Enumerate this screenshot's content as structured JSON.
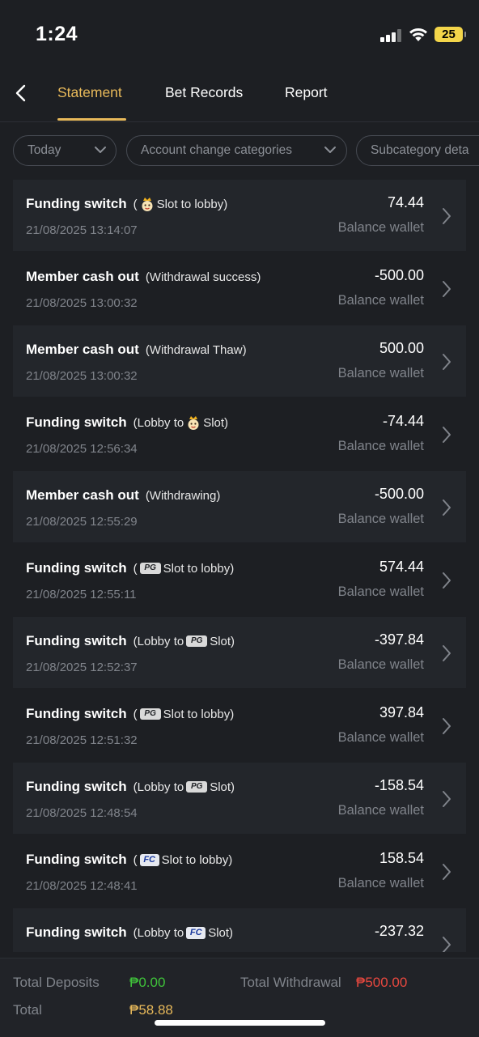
{
  "status_bar": {
    "time": "1:24",
    "battery": "25"
  },
  "nav": {
    "tabs": [
      {
        "label": "Statement",
        "active": true
      },
      {
        "label": "Bet Records",
        "active": false
      },
      {
        "label": "Report",
        "active": false
      }
    ]
  },
  "filters": [
    {
      "label": "Today"
    },
    {
      "label": "Account change categories"
    },
    {
      "label": "Subcategory deta"
    }
  ],
  "rows": [
    {
      "title": "Funding switch",
      "detail_pre": "(",
      "logo": "mascot",
      "detail_post": "Slot to lobby)",
      "date": "21/08/2025 13:14:07",
      "amount": "74.44",
      "wallet": "Balance wallet"
    },
    {
      "title": "Member cash out",
      "detail_pre": "(Withdrawal success)",
      "logo": "",
      "detail_post": "",
      "date": "21/08/2025 13:00:32",
      "amount": "-500.00",
      "wallet": "Balance wallet"
    },
    {
      "title": "Member cash out",
      "detail_pre": "(Withdrawal Thaw)",
      "logo": "",
      "detail_post": "",
      "date": "21/08/2025 13:00:32",
      "amount": "500.00",
      "wallet": "Balance wallet"
    },
    {
      "title": "Funding switch",
      "detail_pre": "(Lobby to",
      "logo": "mascot",
      "detail_post": "Slot)",
      "date": "21/08/2025 12:56:34",
      "amount": "-74.44",
      "wallet": "Balance wallet"
    },
    {
      "title": "Member cash out",
      "detail_pre": "(Withdrawing)",
      "logo": "",
      "detail_post": "",
      "date": "21/08/2025 12:55:29",
      "amount": "-500.00",
      "wallet": "Balance wallet"
    },
    {
      "title": "Funding switch",
      "detail_pre": "(",
      "logo": "pg",
      "detail_post": "Slot to lobby)",
      "date": "21/08/2025 12:55:11",
      "amount": "574.44",
      "wallet": "Balance wallet"
    },
    {
      "title": "Funding switch",
      "detail_pre": "(Lobby to",
      "logo": "pg",
      "detail_post": "Slot)",
      "date": "21/08/2025 12:52:37",
      "amount": "-397.84",
      "wallet": "Balance wallet"
    },
    {
      "title": "Funding switch",
      "detail_pre": "(",
      "logo": "pg",
      "detail_post": "Slot to lobby)",
      "date": "21/08/2025 12:51:32",
      "amount": "397.84",
      "wallet": "Balance wallet"
    },
    {
      "title": "Funding switch",
      "detail_pre": "(Lobby to",
      "logo": "pg",
      "detail_post": "Slot)",
      "date": "21/08/2025 12:48:54",
      "amount": "-158.54",
      "wallet": "Balance wallet"
    },
    {
      "title": "Funding switch",
      "detail_pre": "(",
      "logo": "fc",
      "detail_post": "Slot to lobby)",
      "date": "21/08/2025 12:48:41",
      "amount": "158.54",
      "wallet": "Balance wallet"
    },
    {
      "title": "Funding switch",
      "detail_pre": "(Lobby to",
      "logo": "fc",
      "detail_post": "Slot)",
      "date": "",
      "amount": "-237.32",
      "wallet": ""
    }
  ],
  "logo_text": {
    "pg": "PG",
    "fc": "FC"
  },
  "footer": {
    "deposits_label": "Total Deposits",
    "deposits_value": "₱0.00",
    "withdrawal_label": "Total Withdrawal",
    "withdrawal_value": "₱500.00",
    "total_label": "Total",
    "total_value": "₱58.88"
  },
  "colors": {
    "background": "#1d1f23",
    "accent": "#e8b95a",
    "deposit_green": "#3fc33a",
    "withdrawal_red": "#e8483f",
    "total_gold": "#e8b95a"
  }
}
